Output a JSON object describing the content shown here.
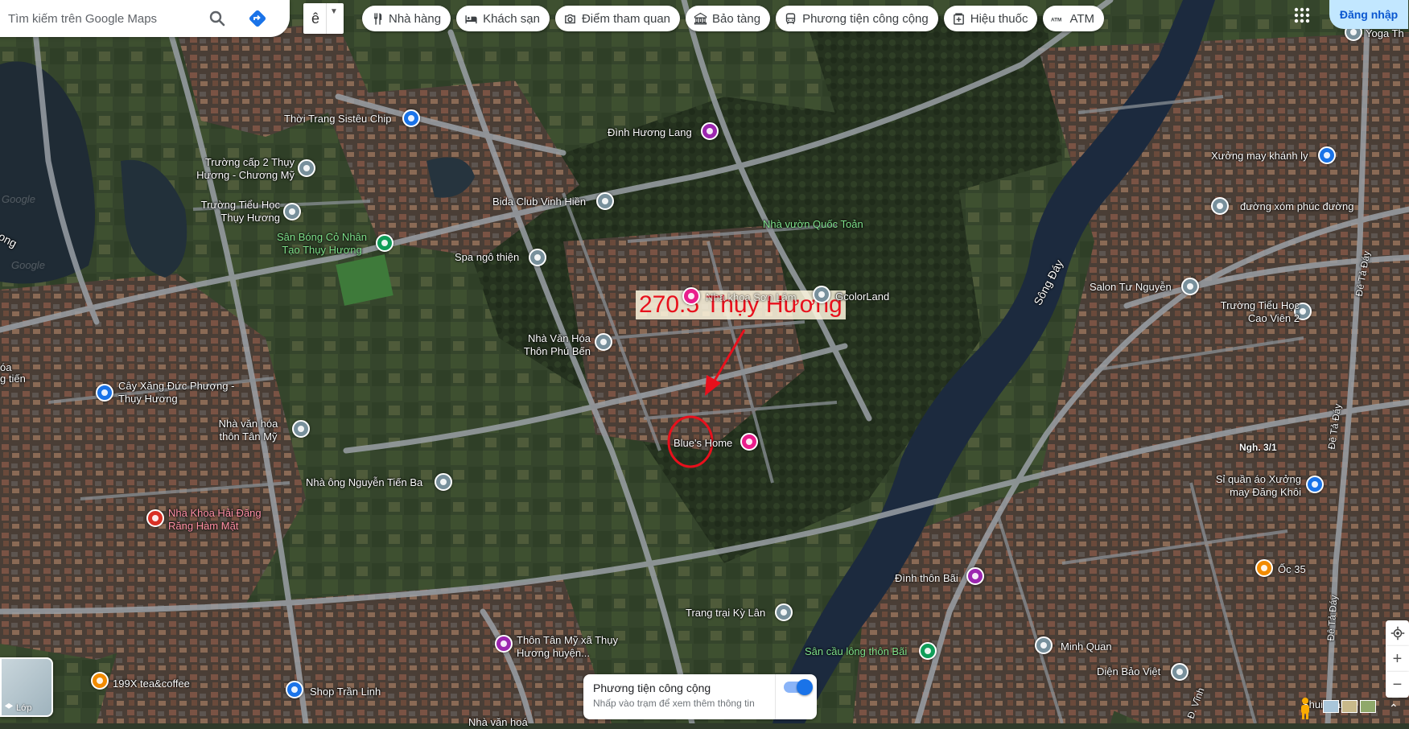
{
  "search": {
    "placeholder": "Tìm kiếm trên Google Maps"
  },
  "language_button": {
    "label": "ê"
  },
  "chips": [
    {
      "label": "Nhà hàng",
      "icon": "restaurant-icon"
    },
    {
      "label": "Khách sạn",
      "icon": "hotel-icon"
    },
    {
      "label": "Điểm tham quan",
      "icon": "camera-icon"
    },
    {
      "label": "Bảo tàng",
      "icon": "museum-icon"
    },
    {
      "label": "Phương tiện công cộng",
      "icon": "bus-icon"
    },
    {
      "label": "Hiệu thuốc",
      "icon": "pharmacy-icon"
    },
    {
      "label": "ATM",
      "icon": "atm-icon"
    }
  ],
  "header": {
    "signin_label": "Đăng nhập"
  },
  "annotation": {
    "title": "270.5 Thụy Hương"
  },
  "places": [
    {
      "name": "Thời Trang Sistêu Chip",
      "style": "white",
      "icon": "shopping-bag-icon",
      "pin": "blue"
    },
    {
      "name": "Đình Hương Lang",
      "style": "white",
      "icon": "temple-icon",
      "pin": "purple"
    },
    {
      "name": "Trường cấp 2 Thụy Hương - Chương Mỹ",
      "style": "white",
      "icon": "school-icon",
      "pin": "grey"
    },
    {
      "name": "Bida Club Vinh Hiền",
      "style": "white",
      "icon": "place-icon",
      "pin": "grey"
    },
    {
      "name": "Trường Tiểu Học Thụy Hương",
      "style": "white",
      "icon": "school-icon",
      "pin": "grey"
    },
    {
      "name": "Nhà vườn Quốc Toản",
      "style": "green",
      "icon": "",
      "pin": ""
    },
    {
      "name": "Sân Bóng Cỏ Nhân Tạo Thụy Hương",
      "style": "green",
      "icon": "stadium-icon",
      "pin": "green"
    },
    {
      "name": "Spa ngô thiện",
      "style": "white",
      "icon": "place-icon",
      "pin": "grey"
    },
    {
      "name": "Nha khoa Sơn Lâm",
      "style": "white",
      "icon": "dentist-icon",
      "pin": "pink"
    },
    {
      "name": "GcolorLand",
      "style": "white",
      "icon": "place-icon",
      "pin": "grey"
    },
    {
      "name": "Nhà Văn Hóa Thôn Phú Bến",
      "style": "white",
      "icon": "place-icon",
      "pin": "grey"
    },
    {
      "name": "Cây Xăng Đức Phượng - Thụy Hương",
      "style": "white",
      "icon": "gas-station-icon",
      "pin": "blue"
    },
    {
      "name": "Blue's Home",
      "style": "white",
      "icon": "hotel-icon",
      "pin": "pink"
    },
    {
      "name": "Nhà văn hóa thôn Tân Mỹ",
      "style": "white",
      "icon": "place-icon",
      "pin": "grey"
    },
    {
      "name": "Nhà ông Nguyễn Tiến Ba",
      "style": "white",
      "icon": "place-icon",
      "pin": "grey"
    },
    {
      "name": "Nha Khoa Hải Đăng Răng Hàm Mặt",
      "style": "pink",
      "icon": "dentist-icon",
      "pin": "red"
    },
    {
      "name": "Trang trại Kỳ Lân",
      "style": "white",
      "icon": "place-icon",
      "pin": "grey"
    },
    {
      "name": "Thôn Tân Mỹ xã Thụy Hương huyện...",
      "style": "white",
      "icon": "temple-icon",
      "pin": "purple"
    },
    {
      "name": "199X tea&coffee",
      "style": "white",
      "icon": "coffee-icon",
      "pin": "orange"
    },
    {
      "name": "Shop Trần Linh",
      "style": "white",
      "icon": "shopping-bag-icon",
      "pin": "blue"
    },
    {
      "name": "Sân cầu lông thôn Bãi",
      "style": "green",
      "icon": "stadium-icon",
      "pin": "green"
    },
    {
      "name": "Đình thôn Bãi",
      "style": "white",
      "icon": "temple-icon",
      "pin": "purple"
    },
    {
      "name": "Minh Quan",
      "style": "white",
      "icon": "person-icon",
      "pin": "grey"
    },
    {
      "name": "Diện Bảo Việt",
      "style": "white",
      "icon": "place-icon",
      "pin": "grey"
    },
    {
      "name": "Ốc 35",
      "style": "white",
      "icon": "restaurant-icon",
      "pin": "orange"
    },
    {
      "name": "Shui Maker",
      "style": "white",
      "icon": "",
      "pin": ""
    },
    {
      "name": "Salon Tư Nguyễn",
      "style": "white",
      "icon": "place-icon",
      "pin": "grey"
    },
    {
      "name": "Trường Tiểu Học Cao Viên 2",
      "style": "white",
      "icon": "school-icon",
      "pin": "grey"
    },
    {
      "name": "Xưởng may khánh ly",
      "style": "white",
      "icon": "shopping-bag-icon",
      "pin": "blue"
    },
    {
      "name": "đường xóm phúc đường",
      "style": "white",
      "icon": "place-icon",
      "pin": "grey"
    },
    {
      "name": "Sỉ quần áo Xưởng may Đăng Khôi",
      "style": "white",
      "icon": "shopping-bag-icon",
      "pin": "blue"
    },
    {
      "name": "Yoga Th",
      "style": "white",
      "icon": "place-icon",
      "pin": "grey"
    },
    {
      "name": "Nhà văn hoá",
      "style": "white",
      "icon": "",
      "pin": ""
    }
  ],
  "roads": [
    {
      "name": "Sông Đáy"
    },
    {
      "name": "Đê Tả Đáy"
    },
    {
      "name": "Đê Tả Đáy"
    },
    {
      "name": "Đê Tả Đáy"
    },
    {
      "name": "Ngh. 3/1"
    },
    {
      "name": "Đ. Vĩnh"
    }
  ],
  "edge_fragments": [
    {
      "text": "ong"
    },
    {
      "text": "óa"
    },
    {
      "text": "g tiến"
    }
  ],
  "watermarks": [
    {
      "text": "Google"
    },
    {
      "text": "Google"
    }
  ],
  "layers_button": {
    "label": "Lớp"
  },
  "transit_card": {
    "title": "Phương tiện công cộng",
    "subtitle": "Nhấp vào trạm để xem thêm thông tin",
    "toggle_on": true
  },
  "map_controls": {
    "zoom_in": "+",
    "zoom_out": "−"
  },
  "colors": {
    "pin_blue": "#1a73e8",
    "pin_purple": "#9c27b0",
    "pin_grey": "#78909c",
    "pin_green": "#0f9d58",
    "pin_pink": "#e91e8c",
    "pin_red": "#d93025",
    "pin_orange": "#f28b00",
    "annotation_red": "#e8101c",
    "river": "#1c2a3e"
  }
}
